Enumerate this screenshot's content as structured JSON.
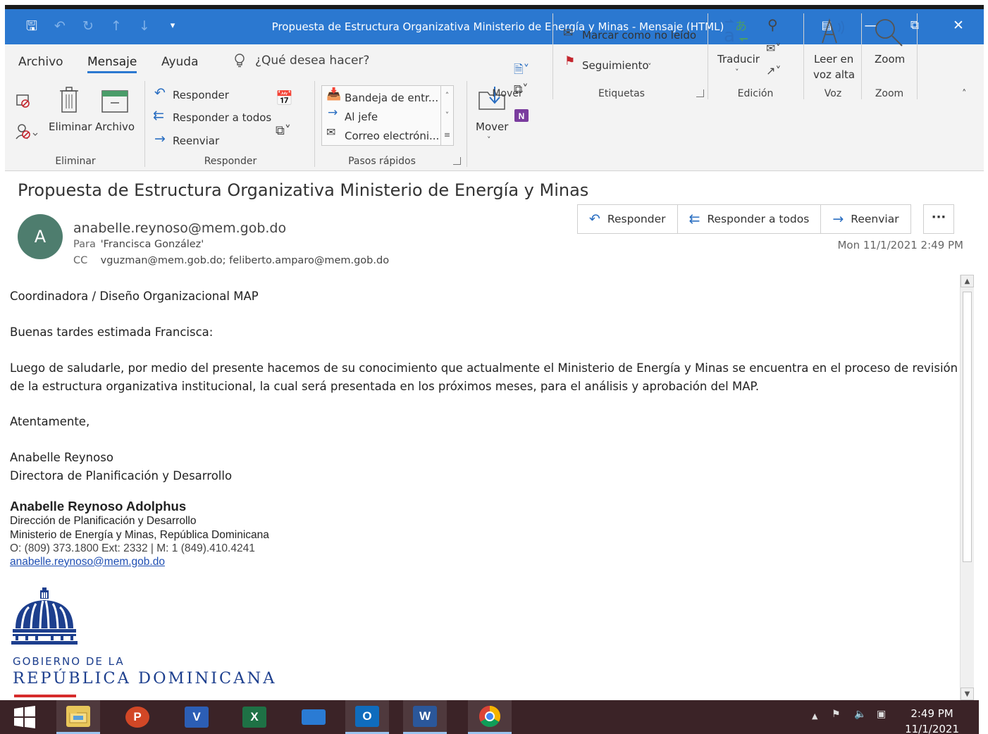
{
  "window": {
    "title": "Propuesta de Estructura Organizativa Ministerio de Energía y Minas  -  Mensaje (HTML)"
  },
  "menu": {
    "tabs": [
      "Archivo",
      "Mensaje",
      "Ayuda"
    ],
    "active_tab": "Mensaje",
    "tell_me": "¿Qué desea hacer?"
  },
  "ribbon": {
    "eliminar": {
      "group": "Eliminar",
      "delete": "Eliminar",
      "archive": "Archivo"
    },
    "responder": {
      "group": "Responder",
      "reply": "Responder",
      "reply_all": "Responder a todos",
      "forward": "Reenviar"
    },
    "pasos": {
      "group": "Pasos rápidos",
      "items": [
        "Bandeja de entr...",
        "Al jefe",
        "Correo electróni..."
      ]
    },
    "mover": {
      "group": "Mover",
      "move": "Mover"
    },
    "etiquetas": {
      "group": "Etiquetas",
      "mark_unread": "Marcar como no leído",
      "follow_up": "Seguimiento"
    },
    "edicion": {
      "group": "Edición",
      "translate": "Traducir"
    },
    "voz": {
      "group": "Voz",
      "read_aloud_1": "Leer en",
      "read_aloud_2": "voz alta"
    },
    "zoom": {
      "group": "Zoom",
      "zoom": "Zoom"
    }
  },
  "message": {
    "subject": "Propuesta de Estructura Organizativa Ministerio de Energía y Minas",
    "avatar_initial": "A",
    "from": "anabelle.reynoso@mem.gob.do",
    "to_label": "Para",
    "to": "'Francisca González'",
    "cc_label": "CC",
    "cc": "vguzman@mem.gob.do; feliberto.amparo@mem.gob.do",
    "date": "Mon 11/1/2021 2:49 PM",
    "actions": {
      "reply": "Responder",
      "reply_all": "Responder a todos",
      "forward": "Reenviar",
      "more": "···"
    }
  },
  "body": {
    "line1": "Coordinadora / Diseño Organizacional MAP",
    "greeting": "Buenas tardes estimada Francisca:",
    "paragraph_1": "Luego de saludarle, por medio del presente hacemos de su conocimiento que actualmente el Ministerio de Energía y Minas se encuentra en el proceso de revisión",
    "paragraph_2": "de la estructura organizativa institucional, la cual será presentada en los próximos meses, para el análisis y aprobación del MAP.",
    "closing": "Atentamente,",
    "name": "Anabelle Reynoso",
    "role": "Directora de Planificación y Desarrollo"
  },
  "signature": {
    "name": "Anabelle Reynoso Adolphus",
    "dept": "Dirección de Planificación y Desarrollo",
    "org": "Ministerio de Energía y Minas, República Dominicana",
    "phone": "O: (809) 373.1800 Ext: 2332 | M: 1 (849).410.4241",
    "email": "anabelle.reynoso@mem.gob.do",
    "logo_line1": "GOBIERNO DE LA",
    "logo_line2": "REPÚBLICA DOMINICANA"
  },
  "taskbar": {
    "apps": [
      "start-icon",
      "file-explorer-icon",
      "powerpoint-icon",
      "visio-icon",
      "excel-icon",
      "desktop-app-icon",
      "outlook-icon",
      "word-icon",
      "chrome-icon"
    ],
    "ppt": "P",
    "visio": "V",
    "excel": "X",
    "outlook": "O",
    "word": "W",
    "time": "2:49 PM",
    "date": "11/1/2021"
  },
  "colors": {
    "title_bar": "#2b78d0",
    "avatar": "#4e7d6e",
    "taskbar": "#3b2327",
    "logo_blue": "#1d3f8e",
    "logo_red": "#d62b2b"
  }
}
